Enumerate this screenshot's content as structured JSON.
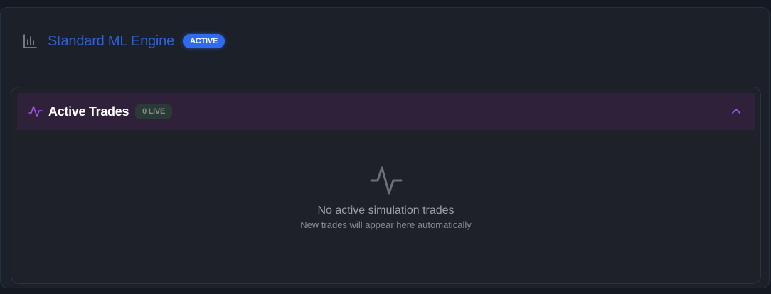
{
  "engine": {
    "title": "Standard ML Engine",
    "status_badge": "ACTIVE",
    "icon": "bar-chart-icon"
  },
  "trades_panel": {
    "title": "Active Trades",
    "live_badge": "0 LIVE",
    "icon": "activity-pulse-icon",
    "collapse_icon": "chevron-up-icon",
    "empty_state": {
      "icon": "activity-pulse-icon",
      "title": "No active simulation trades",
      "subtitle": "New trades will appear here automatically"
    }
  },
  "colors": {
    "accent_blue": "#2f6bf0",
    "accent_purple": "#a855f7",
    "header_bar_bg": "#2e2139"
  }
}
